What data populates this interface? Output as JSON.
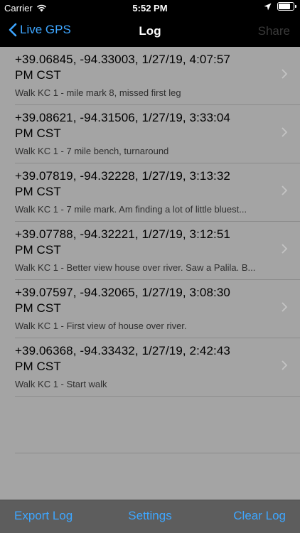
{
  "status": {
    "carrier": "Carrier",
    "time": "5:52 PM"
  },
  "nav": {
    "back_label": "Live GPS",
    "title": "Log",
    "share_label": "Share"
  },
  "entries": [
    {
      "line1": "+39.06845, -94.33003, 1/27/19, 4:07:57",
      "line2": "PM CST",
      "note": "Walk KC 1 - mile mark 8, missed first leg"
    },
    {
      "line1": "+39.08621, -94.31506, 1/27/19, 3:33:04",
      "line2": "PM CST",
      "note": "Walk KC 1 - 7 mile bench, turnaround"
    },
    {
      "line1": "+39.07819, -94.32228, 1/27/19, 3:13:32",
      "line2": "PM CST",
      "note": "Walk KC 1 - 7 mile mark. Am finding a lot of little bluest..."
    },
    {
      "line1": "+39.07788, -94.32221, 1/27/19, 3:12:51",
      "line2": "PM CST",
      "note": "Walk KC 1 - Better view house over river. Saw a Palila. B..."
    },
    {
      "line1": "+39.07597, -94.32065, 1/27/19, 3:08:30",
      "line2": "PM CST",
      "note": "Walk KC 1 - First view of house over river."
    },
    {
      "line1": "+39.06368, -94.33432, 1/27/19, 2:42:43",
      "line2": "PM CST",
      "note": "Walk KC 1 - Start walk"
    }
  ],
  "toolbar": {
    "export_label": "Export Log",
    "settings_label": "Settings",
    "clear_label": "Clear Log"
  },
  "colors": {
    "accent": "#3ea6ff",
    "background": "#a4a4a4",
    "bar": "#000000",
    "toolbar": "#5d5d5d"
  }
}
